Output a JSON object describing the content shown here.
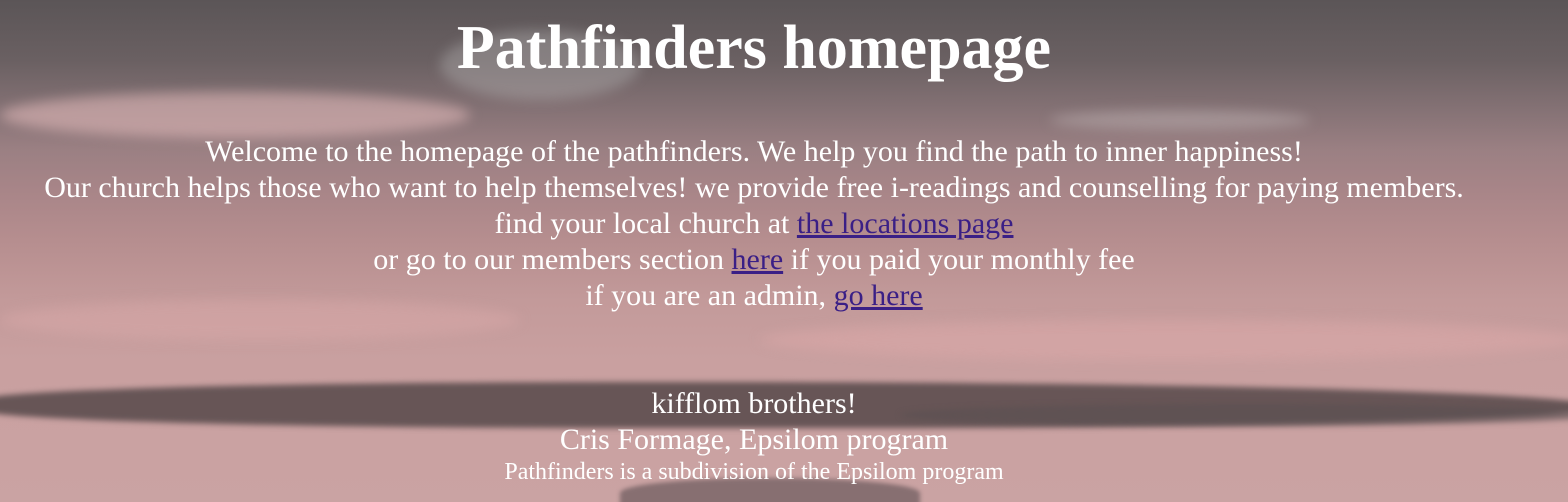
{
  "page": {
    "title": "Pathfinders homepage"
  },
  "intro": {
    "line1": "Welcome to the homepage of the pathfinders. We help you find the path to inner happiness!",
    "line2": "Our church helps those who want to help themselves! we provide free i-readings and counselling for paying members.",
    "line3_prefix": "find your local church at ",
    "line3_link": "the locations page",
    "line4_prefix": "or go to our members section ",
    "line4_link": "here",
    "line4_suffix": " if you paid your monthly fee",
    "line5_prefix": "if you are an admin, ",
    "line5_link": "go here"
  },
  "signoff": {
    "greeting": "kifflom brothers!",
    "author": "Cris Formage, Epsilom program",
    "note": "Pathfinders is a subdivision of the Epsilom program"
  },
  "colors": {
    "text": "#ffffff",
    "link": "#3a1f86"
  }
}
